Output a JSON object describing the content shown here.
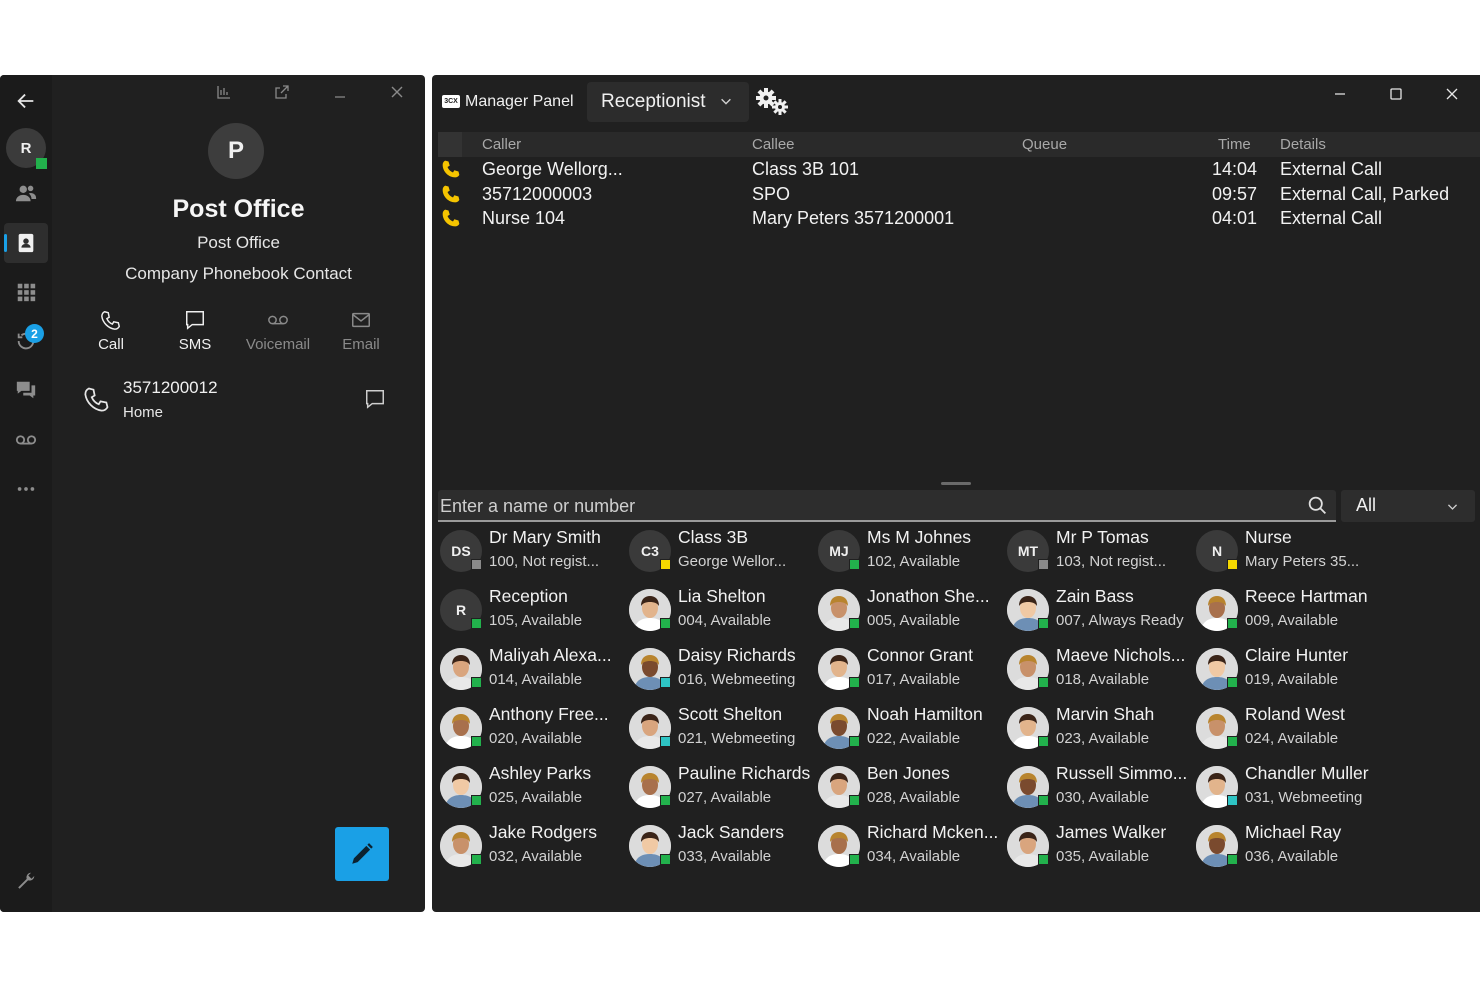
{
  "left_panel": {
    "user_initial": "R",
    "missed_badge": "2",
    "contact": {
      "initial": "P",
      "name": "Post Office",
      "company": "Post Office",
      "type": "Company Phonebook Contact"
    },
    "actions": {
      "call": "Call",
      "sms": "SMS",
      "voicemail": "Voicemail",
      "email": "Email"
    },
    "phone": {
      "number": "3571200012",
      "label": "Home"
    }
  },
  "manager": {
    "app_logo": "3CX",
    "title": "Manager Panel",
    "mode": "Receptionist",
    "calls_columns": {
      "caller": "Caller",
      "callee": "Callee",
      "queue": "Queue",
      "time": "Time",
      "details": "Details"
    },
    "calls": [
      {
        "caller": "George Wellorg...",
        "callee": "Class 3B 101",
        "queue": "",
        "time": "14:04",
        "details": "External Call"
      },
      {
        "caller": "35712000003",
        "callee": "SPO",
        "queue": "",
        "time": "09:57",
        "details": "External Call, Parked"
      },
      {
        "caller": "Nurse 104",
        "callee": "Mary Peters 3571200001",
        "queue": "",
        "time": "04:01",
        "details": "External Call"
      }
    ],
    "search_placeholder": "Enter a name or number",
    "filter_value": "All",
    "extensions": [
      {
        "name": "Dr Mary Smith",
        "sub": "100, Not regist...",
        "initials": "DS",
        "status": "gray"
      },
      {
        "name": "Class 3B",
        "sub": "George Wellor...",
        "initials": "C3",
        "status": "yellow"
      },
      {
        "name": "Ms M Johnes",
        "sub": "102, Available",
        "initials": "MJ",
        "status": "green"
      },
      {
        "name": "Mr P Tomas",
        "sub": "103, Not regist...",
        "initials": "MT",
        "status": "gray"
      },
      {
        "name": "Nurse",
        "sub": "Mary Peters 35...",
        "initials": "N",
        "status": "yellow"
      },
      {
        "name": "Reception",
        "sub": "105, Available",
        "initials": "R",
        "status": "green"
      },
      {
        "name": "Lia Shelton",
        "sub": "004, Available",
        "initials": "",
        "status": "green"
      },
      {
        "name": "Jonathon She...",
        "sub": "005, Available",
        "initials": "",
        "status": "green"
      },
      {
        "name": "Zain Bass",
        "sub": "007, Always Ready",
        "initials": "",
        "status": "green"
      },
      {
        "name": "Reece Hartman",
        "sub": "009, Available",
        "initials": "",
        "status": "green"
      },
      {
        "name": "Maliyah Alexa...",
        "sub": "014, Available",
        "initials": "",
        "status": "green"
      },
      {
        "name": "Daisy Richards",
        "sub": "016, Webmeeting",
        "initials": "",
        "status": "teal"
      },
      {
        "name": "Connor Grant",
        "sub": "017, Available",
        "initials": "",
        "status": "green"
      },
      {
        "name": "Maeve Nichols...",
        "sub": "018, Available",
        "initials": "",
        "status": "green"
      },
      {
        "name": "Claire Hunter",
        "sub": "019, Available",
        "initials": "",
        "status": "green"
      },
      {
        "name": "Anthony Free...",
        "sub": "020, Available",
        "initials": "",
        "status": "green"
      },
      {
        "name": "Scott Shelton",
        "sub": "021, Webmeeting",
        "initials": "",
        "status": "teal"
      },
      {
        "name": "Noah Hamilton",
        "sub": "022, Available",
        "initials": "",
        "status": "green"
      },
      {
        "name": "Marvin Shah",
        "sub": "023, Available",
        "initials": "",
        "status": "green"
      },
      {
        "name": "Roland West",
        "sub": "024, Available",
        "initials": "",
        "status": "green"
      },
      {
        "name": "Ashley Parks",
        "sub": "025, Available",
        "initials": "",
        "status": "green"
      },
      {
        "name": "Pauline Richards",
        "sub": "027, Available",
        "initials": "",
        "status": "green"
      },
      {
        "name": "Ben Jones",
        "sub": "028, Available",
        "initials": "",
        "status": "green"
      },
      {
        "name": "Russell Simmo...",
        "sub": "030, Available",
        "initials": "",
        "status": "green"
      },
      {
        "name": "Chandler Muller",
        "sub": "031, Webmeeting",
        "initials": "",
        "status": "teal"
      },
      {
        "name": "Jake Rodgers",
        "sub": "032, Available",
        "initials": "",
        "status": "green"
      },
      {
        "name": "Jack Sanders",
        "sub": "033, Available",
        "initials": "",
        "status": "green"
      },
      {
        "name": "Richard Mcken...",
        "sub": "034, Available",
        "initials": "",
        "status": "green"
      },
      {
        "name": "James Walker",
        "sub": "035, Available",
        "initials": "",
        "status": "green"
      },
      {
        "name": "Michael Ray",
        "sub": "036, Available",
        "initials": "",
        "status": "green"
      }
    ]
  },
  "colors": {
    "accent": "#1aa0e6",
    "call_icon": "#f5c400",
    "green": "#22b14c",
    "yellow": "#f5d800",
    "teal": "#2ec4c4",
    "gray": "#8a8a8a"
  }
}
